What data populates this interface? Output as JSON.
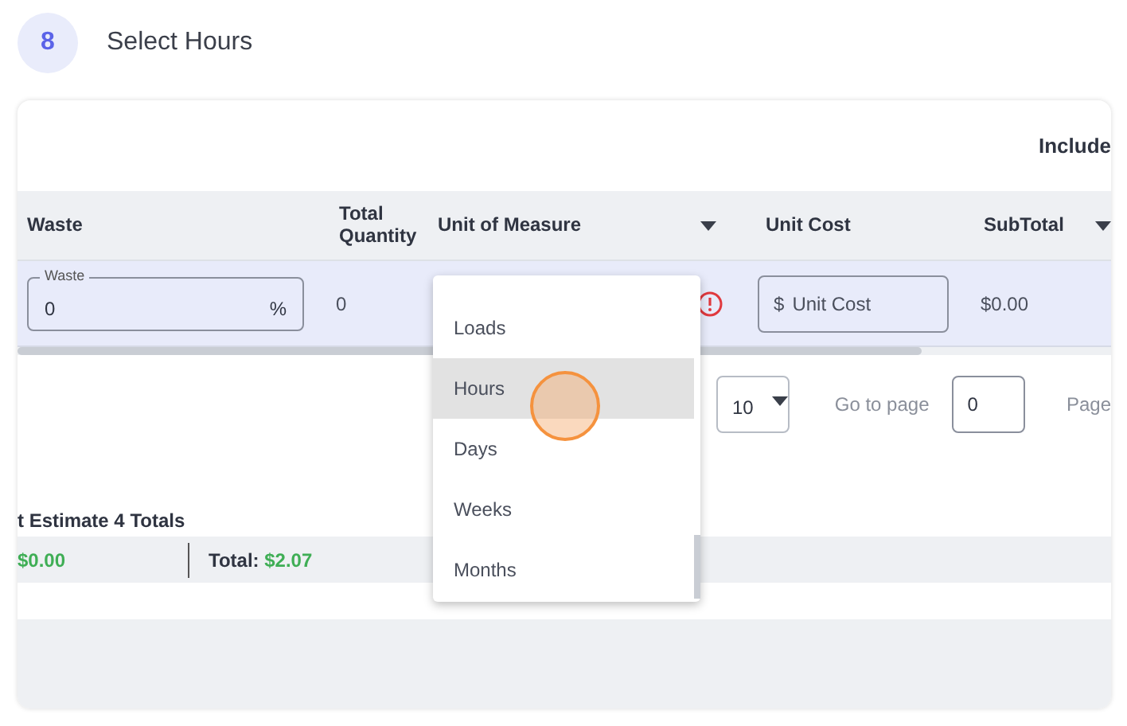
{
  "step": {
    "number": "8",
    "title": "Select Hours"
  },
  "include_label": "Include",
  "table": {
    "columns": [
      {
        "label": "Waste",
        "sortable": false
      },
      {
        "label": "Total Quantity",
        "sortable": false
      },
      {
        "label": "Unit of Measure",
        "sortable": true
      },
      {
        "label": "Unit Cost",
        "sortable": false
      },
      {
        "label": "SubTotal",
        "sortable": true
      }
    ],
    "row": {
      "waste": {
        "label": "Waste",
        "value": "0",
        "suffix": "%"
      },
      "total_quantity": "0",
      "unit_of_measure": {
        "error": true
      },
      "unit_cost": {
        "prefix": "$",
        "placeholder": "Unit Cost"
      },
      "subtotal": "$0.00"
    }
  },
  "pagination": {
    "page_size": "10",
    "goto_label": "Go to page",
    "goto_value": "0",
    "page_label": "Page"
  },
  "totals": {
    "title": "t Estimate 4 Totals",
    "first_value": "$0.00",
    "total_label": "Total:",
    "total_value": "$2.07"
  },
  "dropdown": {
    "items": [
      {
        "label": "Loads",
        "selected": false
      },
      {
        "label": "Hours",
        "selected": true
      },
      {
        "label": "Days",
        "selected": false
      },
      {
        "label": "Weeks",
        "selected": false
      },
      {
        "label": "Months",
        "selected": false
      }
    ]
  }
}
